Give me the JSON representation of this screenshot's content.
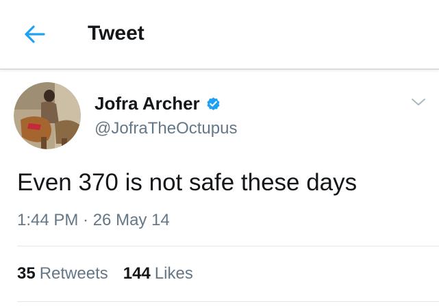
{
  "header": {
    "title": "Tweet",
    "back_icon": "arrow-left-icon"
  },
  "colors": {
    "accent": "#1da1f2",
    "text_primary": "#14171a",
    "text_secondary": "#657786",
    "divider": "#e1e8ed"
  },
  "author": {
    "display_name": "Jofra Archer",
    "handle": "@JofraTheOctupus",
    "verified": true,
    "verified_icon": "verified-badge-icon",
    "avatar_icon": "profile-photo"
  },
  "tweet": {
    "text": "Even 370 is not safe these days",
    "timestamp": "1:44 PM · 26 May 14"
  },
  "stats": {
    "retweets_count": "35",
    "retweets_label": "Retweets",
    "likes_count": "144",
    "likes_label": "Likes"
  },
  "menu_icon": "chevron-down-icon"
}
